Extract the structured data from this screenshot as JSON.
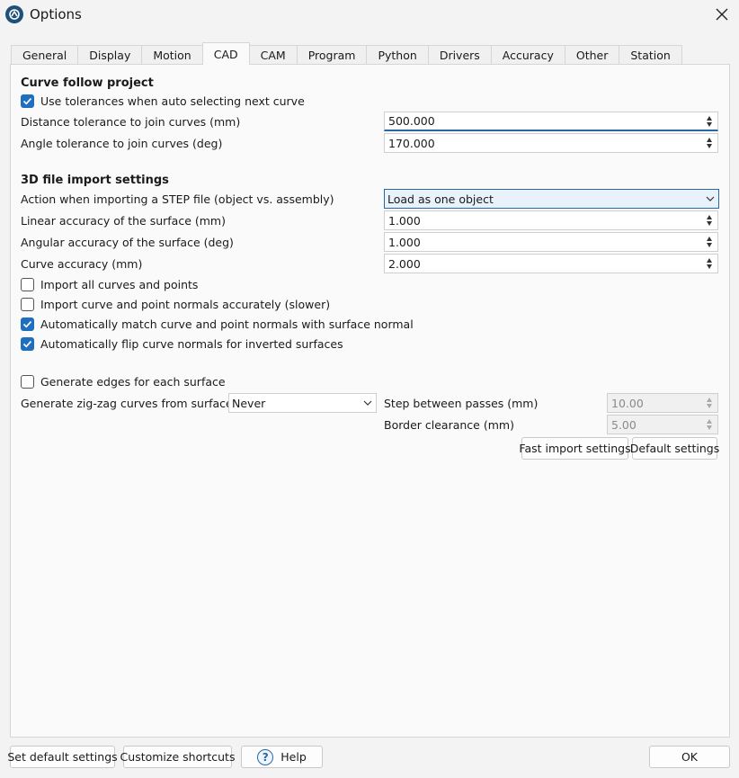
{
  "window": {
    "title": "Options"
  },
  "tabs": [
    "General",
    "Display",
    "Motion",
    "CAD",
    "CAM",
    "Program",
    "Python",
    "Drivers",
    "Accuracy",
    "Other",
    "Station"
  ],
  "active_tab": "CAD",
  "curve_follow": {
    "title": "Curve follow project",
    "use_tolerances": {
      "label": "Use tolerances when auto selecting next curve",
      "checked": true
    },
    "distance_tolerance": {
      "label": "Distance tolerance to join curves (mm)",
      "value": "500.000"
    },
    "angle_tolerance": {
      "label": "Angle tolerance to join curves (deg)",
      "value": "170.000"
    }
  },
  "import_settings": {
    "title": "3D file import settings",
    "step_action": {
      "label": "Action when importing a STEP file (object vs. assembly)",
      "value": "Load as one object"
    },
    "linear_accuracy": {
      "label": "Linear accuracy of the surface (mm)",
      "value": "1.000"
    },
    "angular_accuracy": {
      "label": "Angular accuracy of the surface (deg)",
      "value": "1.000"
    },
    "curve_accuracy": {
      "label": "Curve accuracy (mm)",
      "value": "2.000"
    },
    "import_all": {
      "label": "Import all curves and points",
      "checked": false
    },
    "import_normals": {
      "label": "Import curve and point normals accurately (slower)",
      "checked": false
    },
    "match_normals": {
      "label": "Automatically match curve and point normals with surface normal",
      "checked": true
    },
    "flip_normals": {
      "label": "Automatically flip curve normals for inverted surfaces",
      "checked": true
    },
    "generate_edges": {
      "label": "Generate edges for each surface",
      "checked": false
    },
    "zigzag": {
      "label": "Generate zig-zag curves from surfaces",
      "value": "Never"
    },
    "step_between": {
      "label": "Step between passes (mm)",
      "value": "10.00"
    },
    "border_clearance": {
      "label": "Border clearance (mm)",
      "value": "5.00"
    },
    "fast_import_label": "Fast import settings",
    "default_settings_label": "Default settings"
  },
  "footer": {
    "set_default": "Set default settings",
    "customize": "Customize shortcuts",
    "help": "Help",
    "ok": "OK"
  }
}
